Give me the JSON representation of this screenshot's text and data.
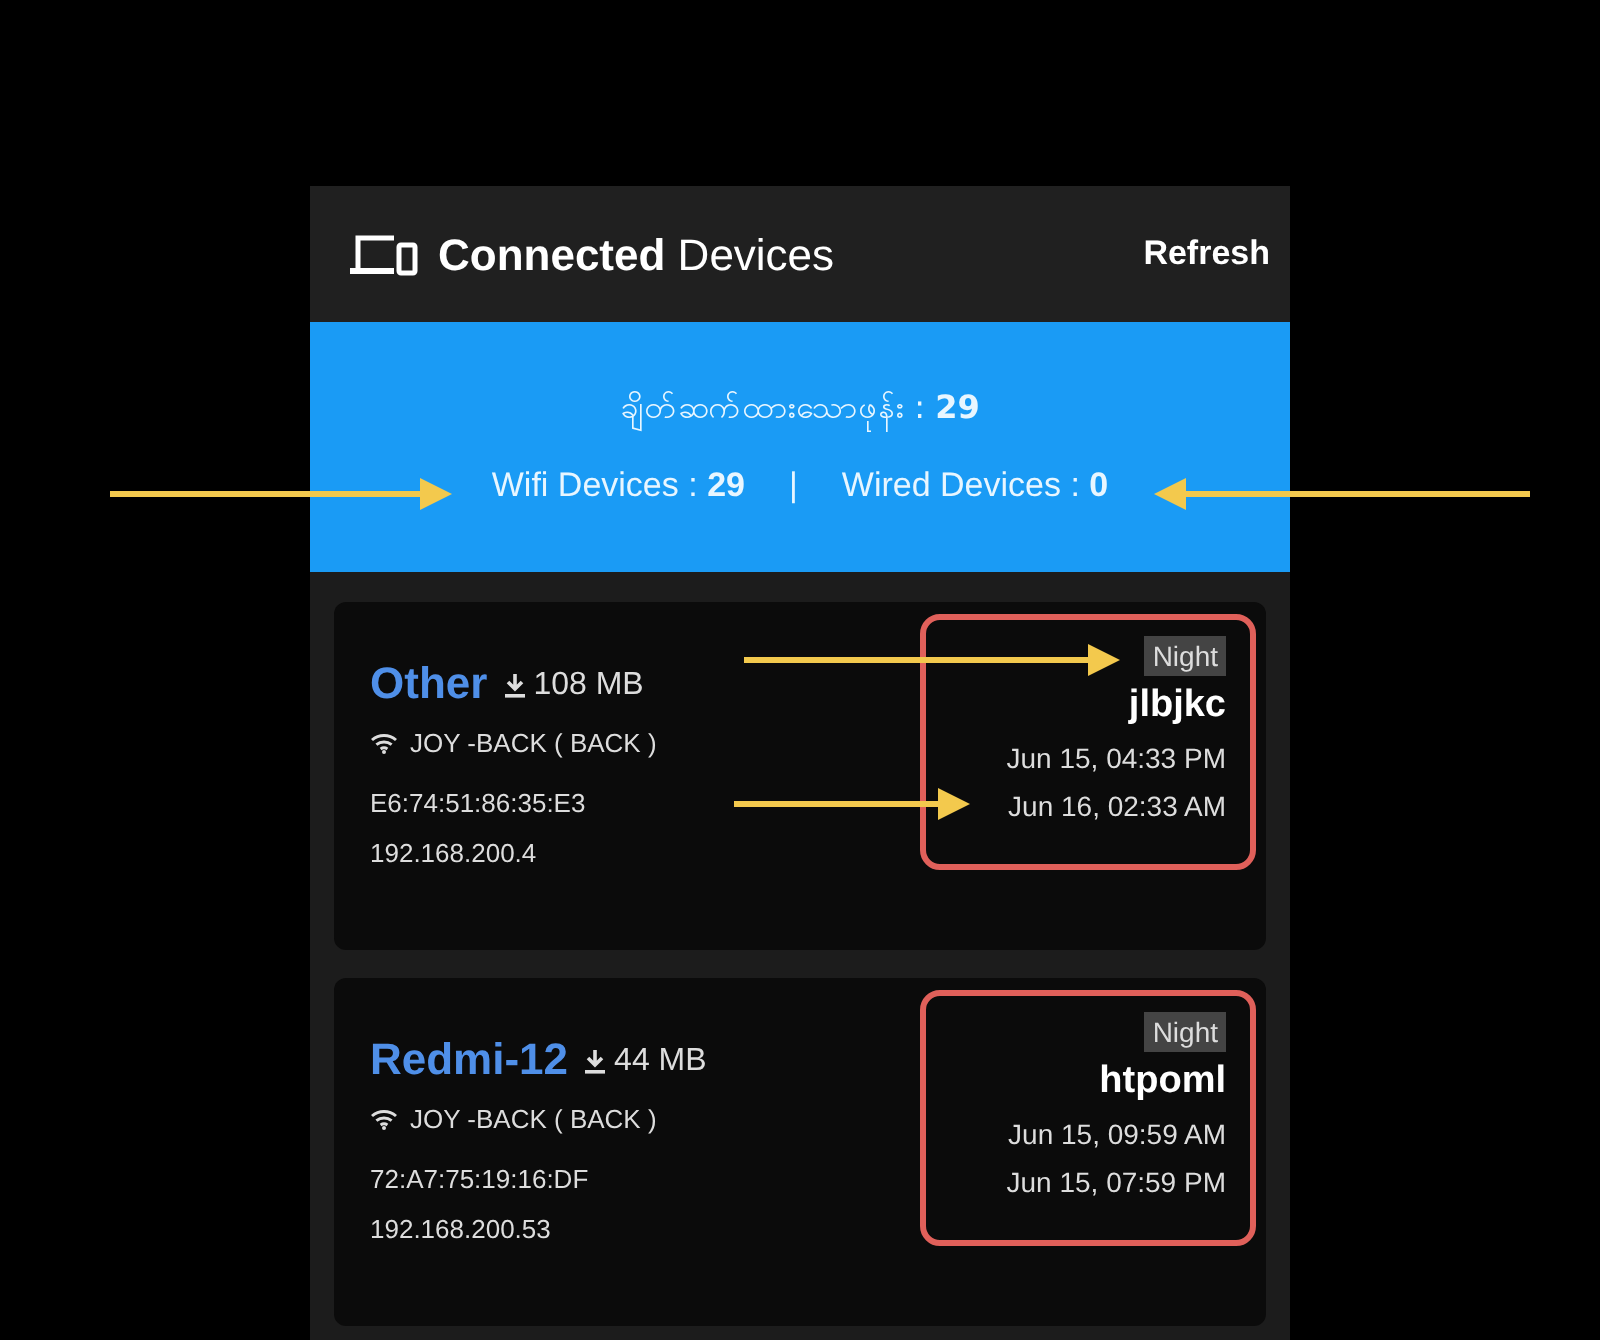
{
  "header": {
    "title": "**Connected** Devices",
    "action": "Refresh"
  },
  "summary": {
    "total": "ချိတ်ဆက်ထားသောဖုန်း : **29**",
    "wifi": "Wifi Devices : **29**",
    "separator": "|",
    "wired": "Wired Devices : **0**"
  },
  "devices": [
    {
      "name": "Other",
      "usage": "108 MB",
      "network": "JOY -BACK ( BACK )",
      "mac": "E6:74:51:86:35:E3",
      "ip": "192.168.200.4",
      "tag": "Night",
      "code": "jlbjkc",
      "start": "Jun 15, 04:33 PM",
      "end": "Jun 16, 02:33 AM"
    },
    {
      "name": "Redmi-12",
      "usage": "44 MB",
      "network": "JOY -BACK ( BACK )",
      "mac": "72:A7:75:19:16:DF",
      "ip": "192.168.200.53",
      "tag": "Night",
      "code": "htpoml",
      "start": "Jun 15, 09:59 AM",
      "end": "Jun 15, 07:59 PM"
    }
  ]
}
